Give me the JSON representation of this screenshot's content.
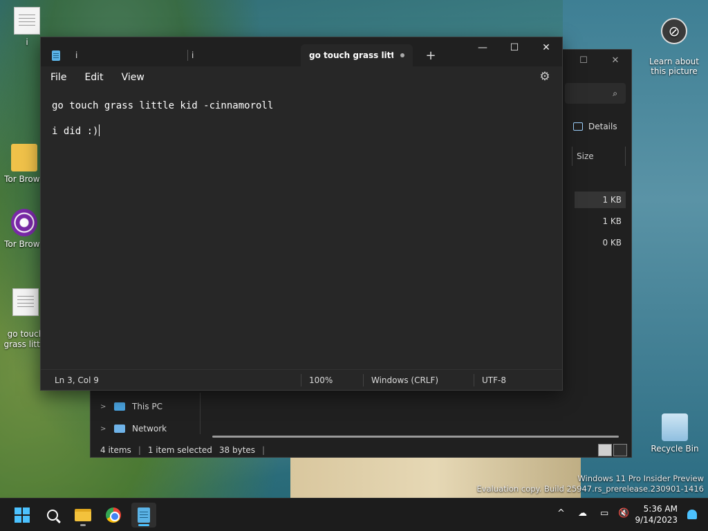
{
  "desktop": {
    "icons": [
      {
        "label": "i",
        "icon": "text-file-icon"
      },
      {
        "label": "Tor Brows",
        "icon": "tor-folder-icon"
      },
      {
        "label": "Tor Brows",
        "icon": "tor-browser-icon"
      },
      {
        "label": "go touch\ngrass little",
        "icon": "text-file-icon"
      }
    ],
    "learn_label": "Learn about\nthis picture",
    "recycle_label": "Recycle Bin",
    "watermark_line1": "Windows 11 Pro Insider Preview",
    "watermark_line2": "Evaluation copy. Build 25947.rs_prerelease.230901-1416"
  },
  "notepad": {
    "tabs": [
      {
        "label": "i"
      },
      {
        "label": "i"
      },
      {
        "label": "go touch grass little k",
        "unsaved": true
      }
    ],
    "new_tab": "+",
    "caption": {
      "minimize": "—",
      "maximize": "☐",
      "close": "✕"
    },
    "menu": {
      "file": "File",
      "edit": "Edit",
      "view": "View"
    },
    "settings_icon": "gear-icon",
    "content": {
      "line1": "go touch grass little kid -cinnamoroll",
      "line3": "i did :)"
    },
    "status": {
      "position": "Ln 3, Col 9",
      "zoom": "100%",
      "line_ending": "Windows (CRLF)",
      "encoding": "UTF-8"
    }
  },
  "explorer": {
    "details_label": "Details",
    "size_header": "Size",
    "sizes": [
      "1 KB",
      "1 KB",
      "0 KB"
    ],
    "nav": [
      {
        "label": "This PC",
        "icon": "this-pc-icon"
      },
      {
        "label": "Network",
        "icon": "network-icon"
      }
    ],
    "status": {
      "items": "4 items",
      "selected": "1 item selected",
      "bytes": "38 bytes"
    }
  },
  "taskbar": {
    "clock_time": "5:36 AM",
    "clock_date": "9/14/2023",
    "apps": [
      "start-icon",
      "search-icon",
      "file-explorer-icon",
      "chrome-icon",
      "notepad-icon"
    ]
  }
}
